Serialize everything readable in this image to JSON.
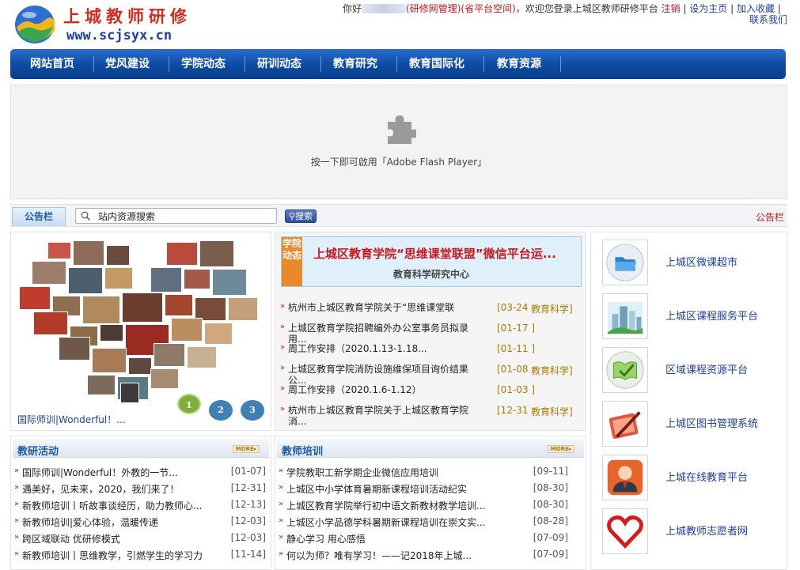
{
  "logo": {
    "title": "上城教师研修",
    "url": "www.scjsyx.cn"
  },
  "toplinks": {
    "greeting": "你好",
    "manage": "(研修网管理)",
    "province_space": "(省平台空间)",
    "welcome": "，欢迎您登录上城区教师研修平台",
    "logout": "注销",
    "set_home": "设为主页",
    "favorite": "加入收藏",
    "contact": "联系我们"
  },
  "nav": {
    "items": [
      "网站首页",
      "党风建设",
      "学院动态",
      "研训动态",
      "教育研究",
      "教育国际化",
      "教育资源"
    ]
  },
  "flash": {
    "text": "按一下即可啟用「Adobe Flash Player」"
  },
  "notice": {
    "tab": "公告栏",
    "search_value": "站内资源搜索",
    "search_button": "搜索",
    "right_label": "公告栏"
  },
  "photo": {
    "caption": "国际师训|Wonderful！...",
    "pages": [
      "1",
      "2",
      "3"
    ]
  },
  "headline": {
    "tag": "学院动态",
    "title": "上城区教育学院“思维课堂联盟”微信平台运...",
    "sub": "教育科学研究中心"
  },
  "news": [
    {
      "title": "杭州市上城区教育学院关于“思维课堂联盟”...",
      "date": "[03-24",
      "cat": "教育科学]"
    },
    {
      "title": "上城区教育学院招聘编外办公室事务员拟录用...",
      "date": "[01-17 ]",
      "cat": ""
    },
    {
      "title": "周工作安排（2020.1.13-1.18...",
      "date": "[01-11 ]",
      "cat": ""
    },
    {
      "title": "上城区教育学院消防设施维保项目询价结果公...",
      "date": "[01-08",
      "cat": "教育科学]"
    },
    {
      "title": "周工作安排（2020.1.6-1.12）",
      "date": "[01-03 ]",
      "cat": ""
    },
    {
      "title": "杭州市上城区教育学院关于上城区教育学院消...",
      "date": "[12-31",
      "cat": "教育科学]"
    }
  ],
  "links": [
    {
      "label": "上城区微课超市",
      "icon": "folder-icon"
    },
    {
      "label": "上城区课程服务平台",
      "icon": "buildings-icon"
    },
    {
      "label": "区域课程资源平台",
      "icon": "book-check-icon"
    },
    {
      "label": "上城区图书管理系统",
      "icon": "pen-book-icon"
    },
    {
      "label": "上城在线教育平台",
      "icon": "person-icon"
    },
    {
      "label": "上城教师志愿者网",
      "icon": "heart-icon"
    }
  ],
  "list_left": {
    "title": "教研活动",
    "more": "MORE▸",
    "items": [
      {
        "title": "国际师训|Wonderful！外教的一节...",
        "date": "[01-07]"
      },
      {
        "title": "遇美好，见未来，2020，我们来了！",
        "date": "[12-31]"
      },
      {
        "title": "新教师培训丨听故事谈经历，助力教师心...",
        "date": "[12-13]"
      },
      {
        "title": "新教师培训|爱心体验，温暖传递",
        "date": "[12-03]"
      },
      {
        "title": "跨区域联动 优研修模式",
        "date": "[12-03]"
      },
      {
        "title": "新教师培训丨思维教学，引燃学生的学习力",
        "date": "[11-14]"
      }
    ]
  },
  "list_right": {
    "title": "教师培训",
    "more": "MORE▸",
    "items": [
      {
        "title": "学院教职工新学期企业微信应用培训",
        "date": "[09-11]"
      },
      {
        "title": "上城区中小学体育暑期新课程培训活动纪实",
        "date": "[08-30]"
      },
      {
        "title": "上城区教育学院举行初中语文新教材教学培训...",
        "date": "[08-30]"
      },
      {
        "title": "上城区小学品德学科暑期新课程培训在崇文实...",
        "date": "[08-28]"
      },
      {
        "title": "静心学习 用心感悟",
        "date": "[07-09]"
      },
      {
        "title": "何以为师？唯有学习！——记2018年上城...",
        "date": "[07-09]"
      }
    ]
  }
}
